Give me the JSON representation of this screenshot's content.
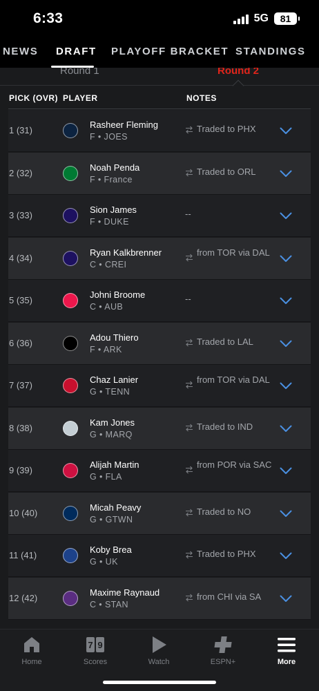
{
  "status": {
    "time": "6:33",
    "network": "5G",
    "battery": "81"
  },
  "top_tabs": [
    "NEWS",
    "DRAFT",
    "PLAYOFF BRACKET",
    "STANDINGS"
  ],
  "round_tabs": [
    "Round 1",
    "Round 2"
  ],
  "headers": {
    "pick": "PICK (OVR)",
    "player": "PLAYER",
    "notes": "NOTES"
  },
  "picks": [
    {
      "pick": "1 (31)",
      "name": "Rasheer Fleming",
      "info": "F • JOES",
      "note": "Traded to PHX",
      "team": "timberwolves-logo",
      "color": "#0c2340"
    },
    {
      "pick": "2 (32)",
      "name": "Noah Penda",
      "info": "F • France",
      "note": "Traded to ORL",
      "team": "celtics-logo",
      "color": "#007a33"
    },
    {
      "pick": "3 (33)",
      "name": "Sion James",
      "info": "F • DUKE",
      "note": "--",
      "team": "hornets-logo",
      "color": "#1d1160"
    },
    {
      "pick": "4 (34)",
      "name": "Ryan Kalkbrenner",
      "info": "C • CREI",
      "note": "from TOR via DAL",
      "team": "hornets-logo",
      "color": "#1d1160"
    },
    {
      "pick": "5 (35)",
      "name": "Johni Broome",
      "info": "C • AUB",
      "note": "--",
      "team": "76ers-logo",
      "color": "#ed174c"
    },
    {
      "pick": "6 (36)",
      "name": "Adou Thiero",
      "info": "F • ARK",
      "note": "Traded to LAL",
      "team": "nets-logo",
      "color": "#000000"
    },
    {
      "pick": "7 (37)",
      "name": "Chaz Lanier",
      "info": "G • TENN",
      "note": "from TOR via DAL",
      "team": "pistons-logo",
      "color": "#c8102e"
    },
    {
      "pick": "8 (38)",
      "name": "Kam Jones",
      "info": "G • MARQ",
      "note": "Traded to IND",
      "team": "spurs-logo",
      "color": "#c4ced4"
    },
    {
      "pick": "9 (39)",
      "name": "Alijah Martin",
      "info": "G • FLA",
      "note": "from POR via SAC",
      "team": "raptors-logo",
      "color": "#ce1141"
    },
    {
      "pick": "10 (40)",
      "name": "Micah Peavy",
      "info": "G • GTWN",
      "note": "Traded to NO",
      "team": "wizards-logo",
      "color": "#002b5c"
    },
    {
      "pick": "11 (41)",
      "name": "Koby Brea",
      "info": "G • UK",
      "note": "Traded to PHX",
      "team": "warriors-logo",
      "color": "#1d428a"
    },
    {
      "pick": "12 (42)",
      "name": "Maxime Raynaud",
      "info": "C • STAN",
      "note": "from CHI via SA",
      "team": "kings-logo",
      "color": "#5a2d81"
    }
  ],
  "tab_bar": [
    {
      "label": "Home",
      "icon": "home-icon"
    },
    {
      "label": "Scores",
      "icon": "scores-icon",
      "digits": "79"
    },
    {
      "label": "Watch",
      "icon": "watch-icon"
    },
    {
      "label": "ESPN+",
      "icon": "espn-plus-icon"
    },
    {
      "label": "More",
      "icon": "more-icon",
      "active": true
    }
  ],
  "colors": {
    "accent": "#e0251b",
    "chevron": "#4a90e2",
    "background": "#1a1b1d"
  }
}
